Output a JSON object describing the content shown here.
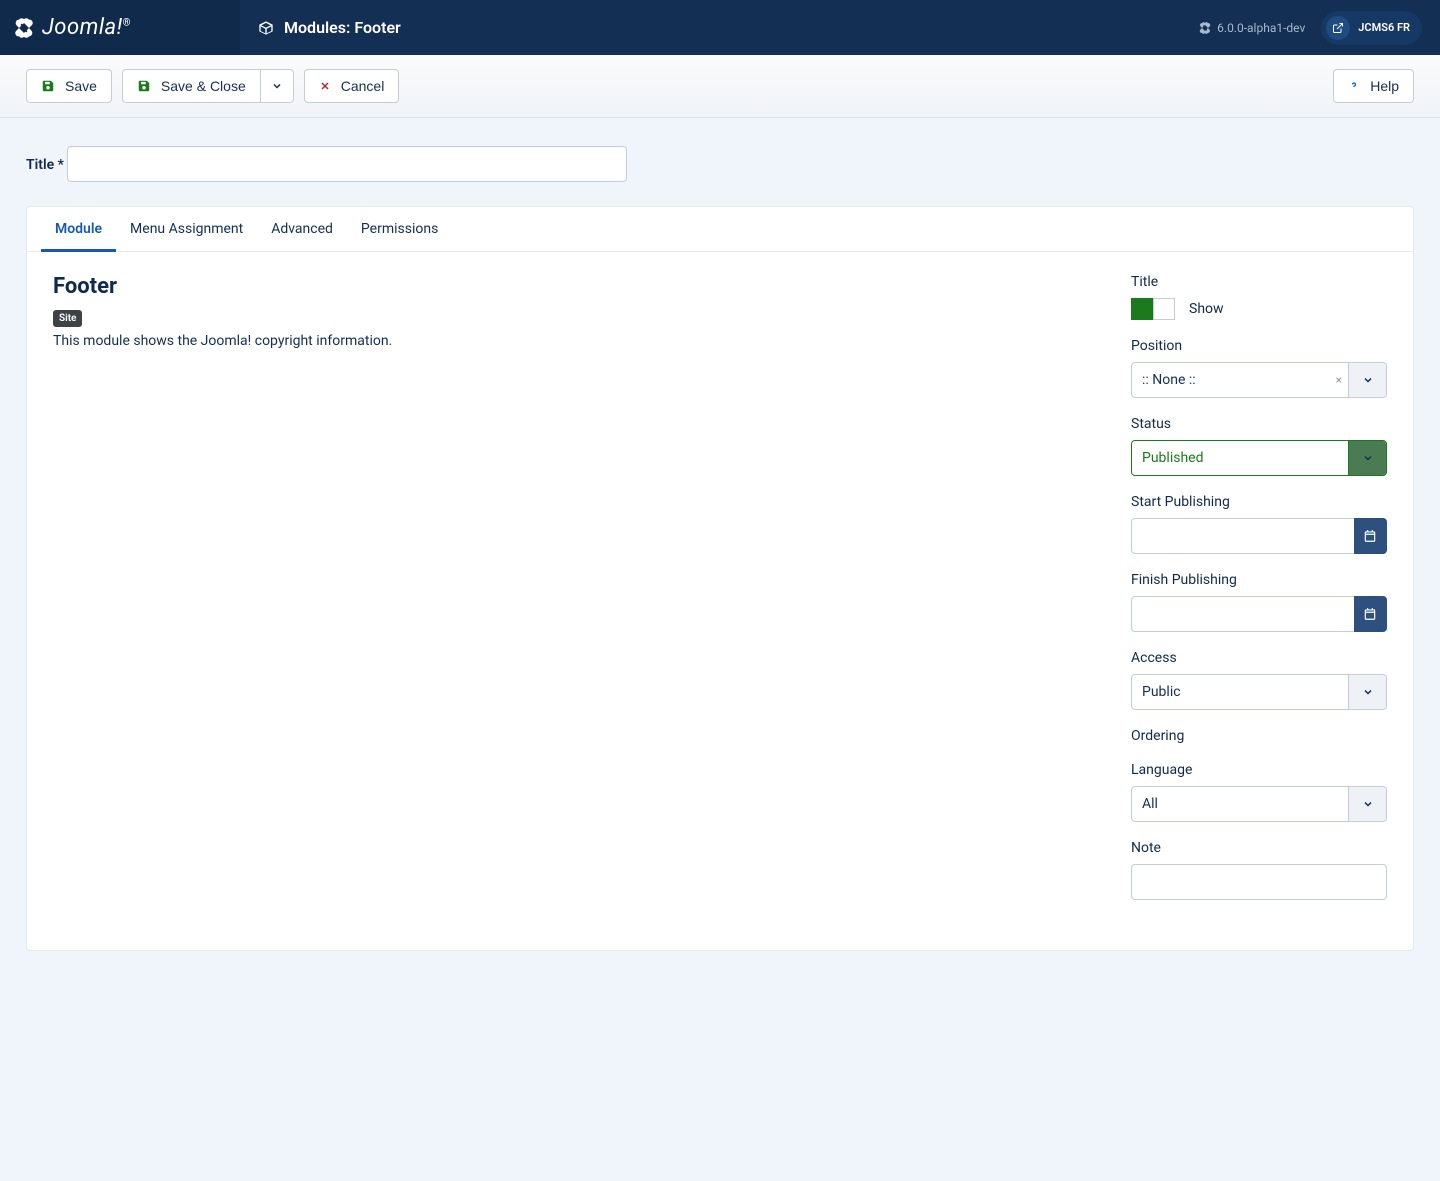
{
  "header": {
    "brand": "Joomla!",
    "pageTitle": "Modules: Footer",
    "version": "6.0.0-alpha1-dev",
    "userLabel": "JCMS6 FR"
  },
  "toolbar": {
    "save": "Save",
    "saveClose": "Save & Close",
    "cancel": "Cancel",
    "help": "Help"
  },
  "title": {
    "label": "Title *",
    "value": ""
  },
  "tabs": {
    "module": "Module",
    "menuAssignment": "Menu Assignment",
    "advanced": "Advanced",
    "permissions": "Permissions"
  },
  "module": {
    "heading": "Footer",
    "badge": "Site",
    "description": "This module shows the Joomla! copyright information."
  },
  "sidebar": {
    "titleField": {
      "label": "Title",
      "optionText": "Show"
    },
    "position": {
      "label": "Position",
      "value": ":: None ::"
    },
    "status": {
      "label": "Status",
      "value": "Published"
    },
    "startPublishing": {
      "label": "Start Publishing",
      "value": ""
    },
    "finishPublishing": {
      "label": "Finish Publishing",
      "value": ""
    },
    "access": {
      "label": "Access",
      "value": "Public"
    },
    "ordering": {
      "label": "Ordering"
    },
    "language": {
      "label": "Language",
      "value": "All"
    },
    "note": {
      "label": "Note",
      "value": ""
    }
  }
}
